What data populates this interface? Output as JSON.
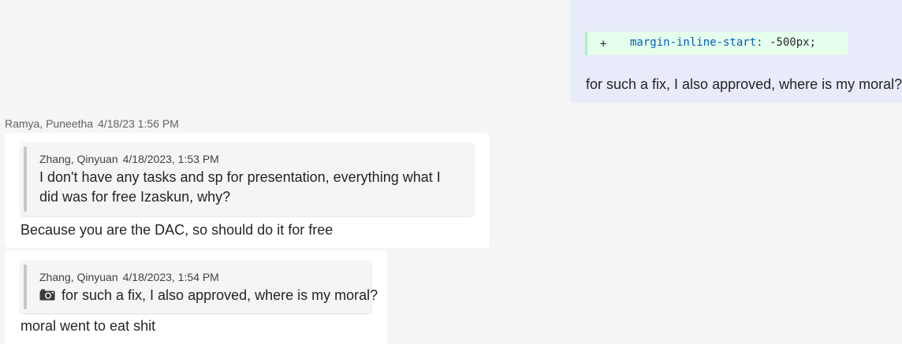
{
  "self_message": {
    "code_diff": {
      "marker": "+",
      "property": "margin-inline-start:",
      "value": "-500px;"
    },
    "text": "for such a fix, I also approved, where is my moral?"
  },
  "sender": {
    "name": "Ramya, Puneetha",
    "timestamp": "4/18/23 1:56 PM"
  },
  "messages": [
    {
      "quote": {
        "author": "Zhang, Qinyuan",
        "timestamp": "4/18/2023, 1:53 PM",
        "text": "I don't have any tasks and sp for presentation, everything what I did was for free Izaskun, why?"
      },
      "text": "Because you are the DAC, so should do it for free"
    },
    {
      "quote": {
        "author": "Zhang, Qinyuan",
        "timestamp": "4/18/2023, 1:54 PM",
        "icon": "camera-icon",
        "text": "for such a fix, I also approved, where is my moral?"
      },
      "text": "moral went to eat shit"
    }
  ]
}
